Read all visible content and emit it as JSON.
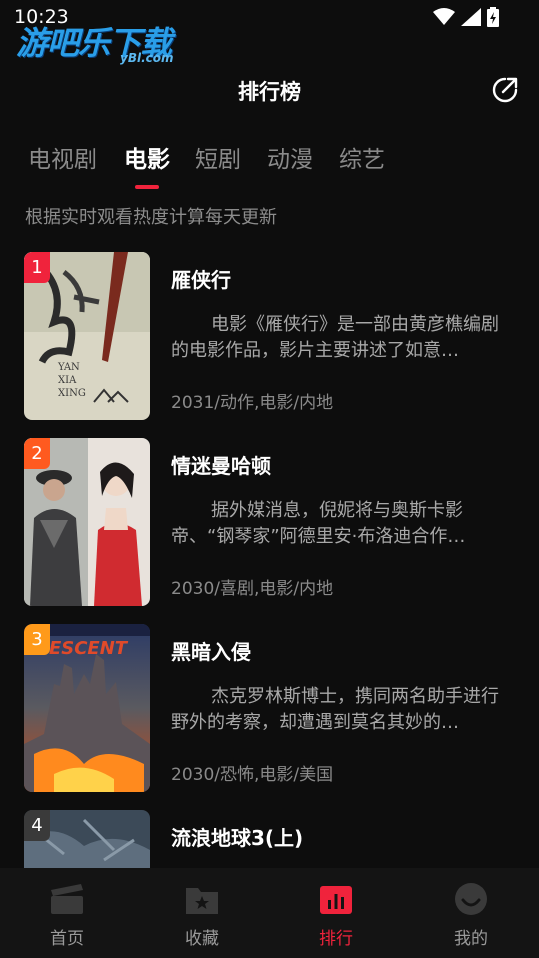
{
  "status_bar": {
    "time": "10:23"
  },
  "watermark": {
    "text": "游吧乐下载",
    "sub": "yBl.com"
  },
  "header": {
    "title": "排行榜"
  },
  "tabs": [
    {
      "label": "电视剧",
      "active": false
    },
    {
      "label": "电影",
      "active": true
    },
    {
      "label": "短剧",
      "active": false
    },
    {
      "label": "动漫",
      "active": false
    },
    {
      "label": "综艺",
      "active": false
    }
  ],
  "subtitle": "根据实时观看热度计算每天更新",
  "items": [
    {
      "rank": "1",
      "title": "雁侠行",
      "desc": "电影《雁侠行》是一部由黄彦樵编剧的电影作品，影片主要讲述了如意…",
      "meta": "2031/动作,电影/内地",
      "poster_title": "YAN XIA XING",
      "rank_color": "#f0233c"
    },
    {
      "rank": "2",
      "title": "情迷曼哈顿",
      "desc": "据外媒消息，倪妮将与奥斯卡影帝、“钢琴家”阿德里安·布洛迪合作…",
      "meta": "2030/喜剧,电影/内地",
      "rank_color": "#ff5a1f"
    },
    {
      "rank": "3",
      "title": "黑暗入侵",
      "desc": "杰克罗林斯博士，携同两名助手进行野外的考察，却遭遇到莫名其妙的…",
      "meta": "2030/恐怖,电影/美国",
      "poster_title": "DESCENT",
      "rank_color": "#ff9a1a"
    },
    {
      "rank": "4",
      "title": "流浪地球3(上)",
      "desc": "",
      "meta": "",
      "rank_color": "#3a3a3a"
    }
  ],
  "bottom_nav": [
    {
      "label": "首页",
      "icon": "clapperboard-icon",
      "active": false
    },
    {
      "label": "收藏",
      "icon": "folder-star-icon",
      "active": false
    },
    {
      "label": "排行",
      "icon": "bar-chart-icon",
      "active": true
    },
    {
      "label": "我的",
      "icon": "smile-face-icon",
      "active": false
    }
  ],
  "colors": {
    "accent": "#f0233c",
    "background": "#0d0d0d",
    "nav_background": "#141414"
  }
}
